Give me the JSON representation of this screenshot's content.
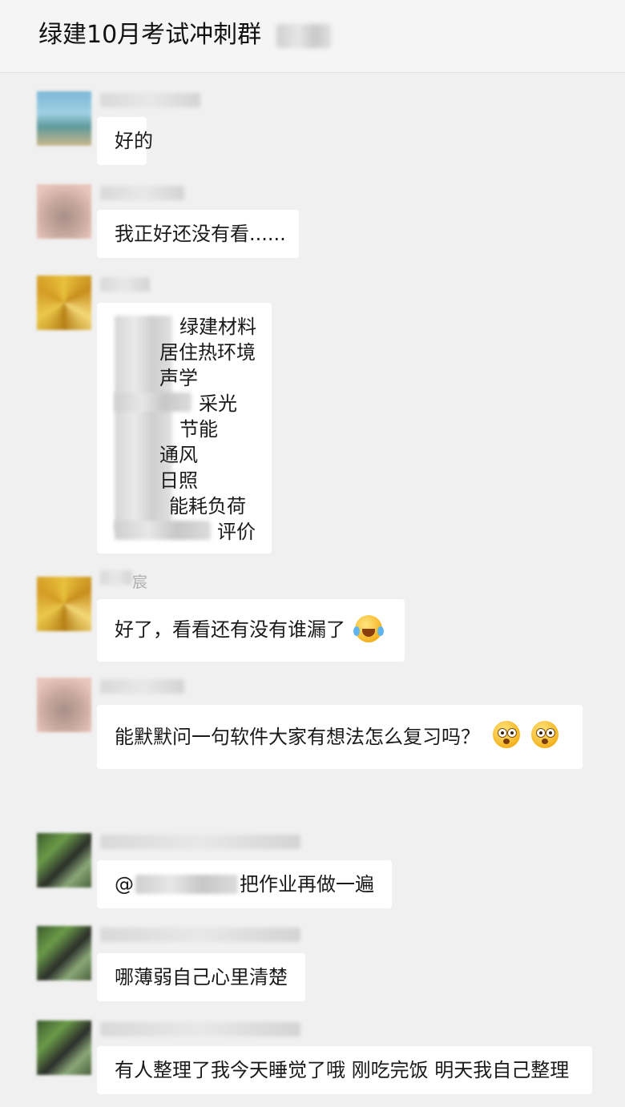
{
  "header": {
    "title": "绿建10月考试冲刺群"
  },
  "messages": [
    {
      "text": "好的"
    },
    {
      "text": "我正好还没有看......"
    },
    {
      "lines": [
        "绿建材料",
        "居住热环境",
        "声学",
        "采光",
        "节能",
        "通风",
        "日照",
        "能耗负荷",
        "评价"
      ]
    },
    {
      "sender_fragment": "宸",
      "text": "好了，看看还有没有谁漏了",
      "emoji": "laughing-crying-emoji"
    },
    {
      "text": "能默默问一句软件大家有想法怎么复习吗？",
      "emojis": [
        "flushed-emoji",
        "flushed-emoji"
      ]
    },
    {
      "mention_symbol": "@",
      "text": "把作业再做一遍"
    },
    {
      "text": "哪薄弱自己心里清楚"
    },
    {
      "text": "有人整理了我今天睡觉了哦 刚吃完饭 明天我自己整理"
    }
  ],
  "colors": {
    "background": "#f0f0f0",
    "bubble": "#ffffff",
    "text": "#1a1a1a"
  }
}
